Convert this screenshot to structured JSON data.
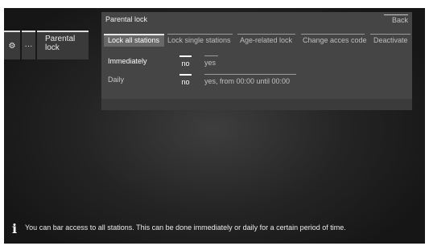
{
  "sidebar": {
    "tabs": [
      {
        "icon": "gear-icon",
        "glyph": "⚙"
      },
      {
        "icon": "ellipsis-icon",
        "glyph": "···"
      },
      {
        "label": "Parental lock"
      }
    ]
  },
  "panel": {
    "title": "Parental lock",
    "back_label": "Back",
    "nav": [
      {
        "label": "Lock all stations",
        "active": true
      },
      {
        "label": "Lock single stations"
      },
      {
        "label": "Age-related lock"
      },
      {
        "label": "Change acces code"
      },
      {
        "label": "Deactivate"
      }
    ],
    "rows": [
      {
        "label": "Immediately",
        "options": [
          "no",
          "yes"
        ],
        "selected": "no"
      },
      {
        "label": "Daily",
        "options": [
          "no",
          "yes, from 00:00 until 00:00"
        ],
        "selected": "no"
      }
    ]
  },
  "info": {
    "icon": "info-icon",
    "text": "You can bar access to all stations. This can be done immediately or daily for a certain period of time."
  }
}
